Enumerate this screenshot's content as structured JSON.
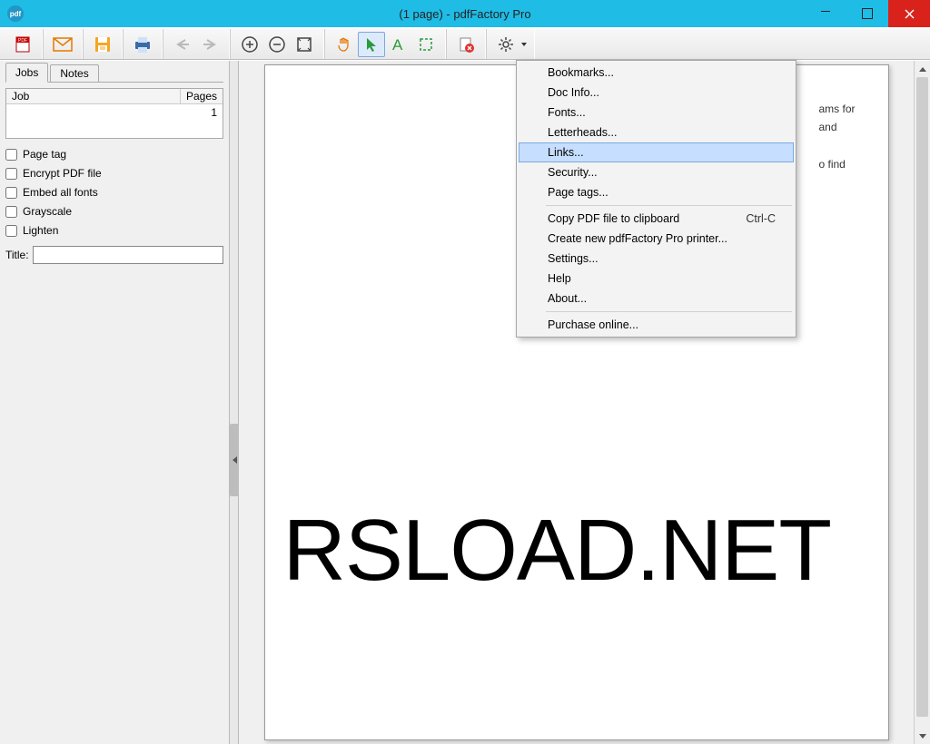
{
  "title": "(1 page) - pdfFactory Pro",
  "app_icon_text": "pdf",
  "sidebar": {
    "tabs": [
      "Jobs",
      "Notes"
    ],
    "table": {
      "headers": {
        "job": "Job",
        "pages": "Pages"
      },
      "row": {
        "job": "",
        "pages": "1"
      }
    },
    "options": [
      "Page tag",
      "Encrypt PDF file",
      "Embed all fonts",
      "Grayscale",
      "Lighten"
    ],
    "title_label": "Title:",
    "title_value": ""
  },
  "page": {
    "visible_text_lines": [
      "ams for",
      "and",
      "o find"
    ],
    "watermark": "RSLOAD.NET"
  },
  "menu": {
    "groups": [
      [
        "Bookmarks...",
        "Doc Info...",
        "Fonts...",
        "Letterheads...",
        "Links...",
        "Security...",
        "Page tags..."
      ],
      [
        {
          "label": "Copy PDF file to clipboard",
          "shortcut": "Ctrl-C"
        },
        "Create new pdfFactory Pro printer...",
        "Settings...",
        "Help",
        "About..."
      ],
      [
        "Purchase online..."
      ]
    ],
    "highlighted": "Links..."
  }
}
